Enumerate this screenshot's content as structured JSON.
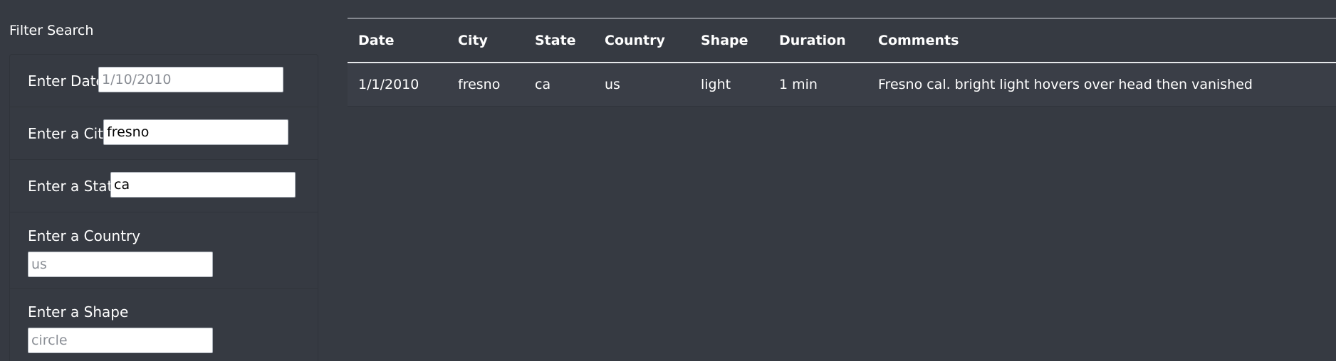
{
  "sidebar": {
    "title": "Filter Search",
    "filters": [
      {
        "label": "Enter Date",
        "value": "",
        "placeholder": "1/10/2010"
      },
      {
        "label": "Enter a City",
        "value": "fresno",
        "placeholder": ""
      },
      {
        "label": "Enter a State",
        "value": "ca",
        "placeholder": ""
      },
      {
        "label": "Enter a Country",
        "value": "",
        "placeholder": "us"
      },
      {
        "label": "Enter a Shape",
        "value": "",
        "placeholder": "circle"
      }
    ]
  },
  "table": {
    "columns": [
      "Date",
      "City",
      "State",
      "Country",
      "Shape",
      "Duration",
      "Comments"
    ],
    "rows": [
      {
        "date": "1/1/2010",
        "city": "fresno",
        "state": "ca",
        "country": "us",
        "shape": "light",
        "duration": "1 min",
        "comments": "Fresno cal. bright light hovers over head then vanished"
      }
    ]
  },
  "colors": {
    "background": "#363a42",
    "row_background": "#3a3e47",
    "text": "#ffffff"
  }
}
